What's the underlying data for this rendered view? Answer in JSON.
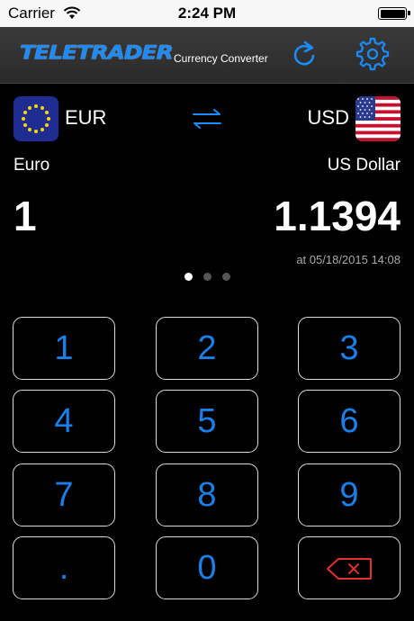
{
  "status": {
    "carrier": "Carrier",
    "time": "2:24 PM"
  },
  "header": {
    "brand": "TELETRADER",
    "title": "Currency Converter"
  },
  "converter": {
    "from": {
      "code": "EUR",
      "name": "Euro",
      "amount": "1"
    },
    "to": {
      "code": "USD",
      "name": "US Dollar",
      "amount": "1.1394"
    },
    "timestamp": "at 05/18/2015 14:08"
  },
  "pager": {
    "count": 3,
    "active": 0
  },
  "keypad": {
    "k1": "1",
    "k2": "2",
    "k3": "3",
    "k4": "4",
    "k5": "5",
    "k6": "6",
    "k7": "7",
    "k8": "8",
    "k9": "9",
    "kdot": ".",
    "k0": "0"
  },
  "colors": {
    "accent": "#1a7fe8",
    "background": "#000000",
    "header": "#333333"
  }
}
